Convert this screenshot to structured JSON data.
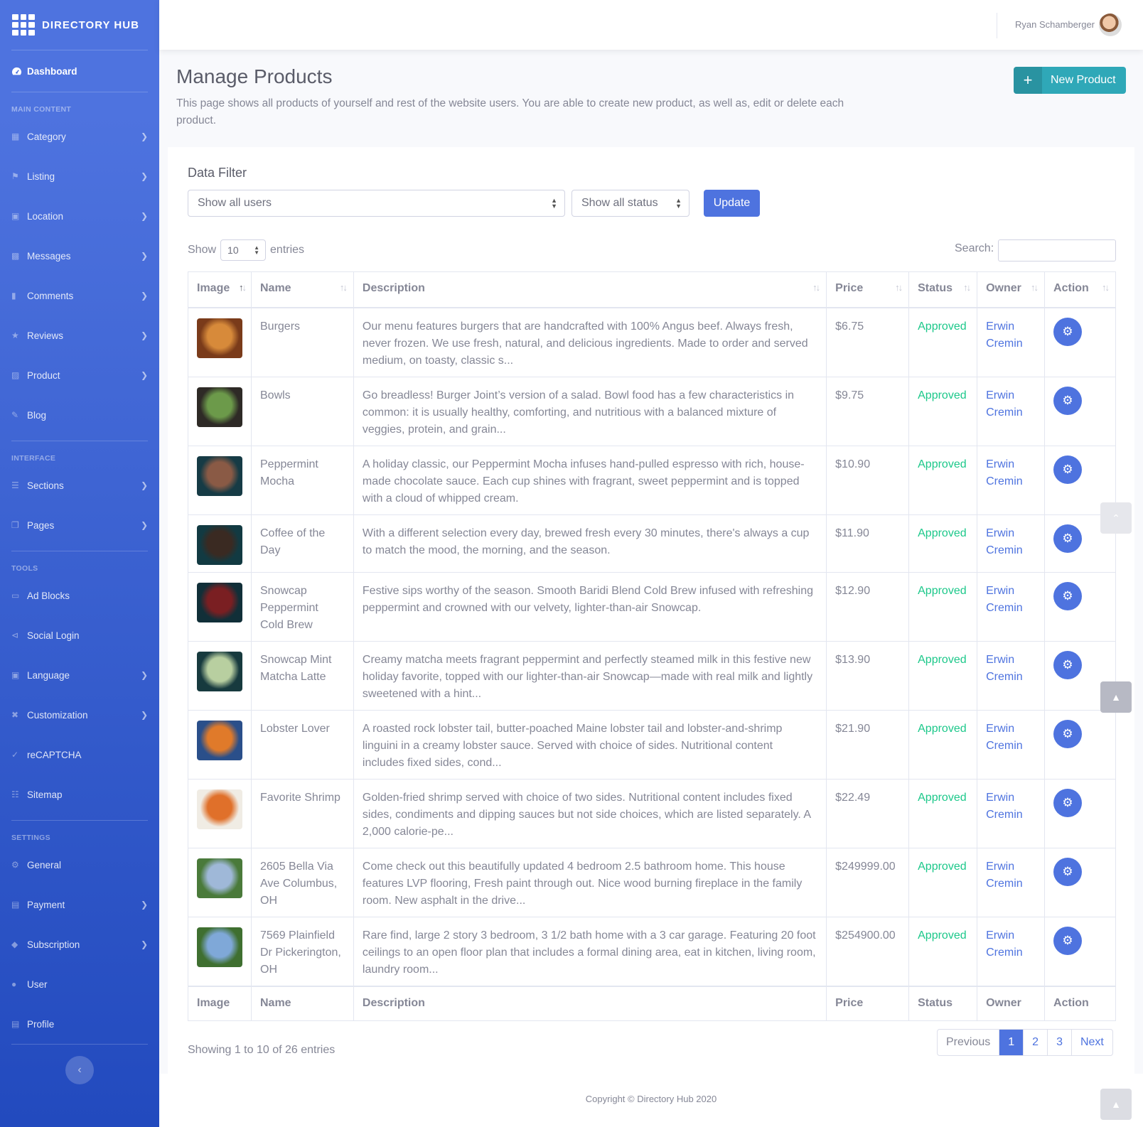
{
  "brand": {
    "name": "DIRECTORY HUB",
    "icon": "grid-icon"
  },
  "sidebar": {
    "dashboard": "Dashboard",
    "groups": [
      {
        "heading": "MAIN CONTENT",
        "items": [
          {
            "key": "category",
            "label": "Category",
            "icon": "th-icon",
            "chevron": true
          },
          {
            "key": "listing",
            "label": "Listing",
            "icon": "flag-icon",
            "chevron": true
          },
          {
            "key": "location",
            "label": "Location",
            "icon": "city-icon",
            "chevron": true
          },
          {
            "key": "messages",
            "label": "Messages",
            "icon": "comments-icon",
            "chevron": true
          },
          {
            "key": "comments",
            "label": "Comments",
            "icon": "comment-icon",
            "chevron": true
          },
          {
            "key": "reviews",
            "label": "Reviews",
            "icon": "star-icon",
            "chevron": true
          },
          {
            "key": "product",
            "label": "Product",
            "icon": "box-icon",
            "chevron": true
          },
          {
            "key": "blog",
            "label": "Blog",
            "icon": "edit-icon",
            "chevron": false
          }
        ]
      },
      {
        "heading": "INTERFACE",
        "items": [
          {
            "key": "sections",
            "label": "Sections",
            "icon": "bars-icon",
            "chevron": true
          },
          {
            "key": "pages",
            "label": "Pages",
            "icon": "copy-icon",
            "chevron": true
          }
        ]
      },
      {
        "heading": "TOOLS",
        "items": [
          {
            "key": "ad-blocks",
            "label": "Ad Blocks",
            "icon": "ad-icon",
            "chevron": false
          },
          {
            "key": "social-login",
            "label": "Social Login",
            "icon": "share-icon",
            "chevron": false
          },
          {
            "key": "language",
            "label": "Language",
            "icon": "language-icon",
            "chevron": true
          },
          {
            "key": "customization",
            "label": "Customization",
            "icon": "tools-icon",
            "chevron": true
          },
          {
            "key": "recaptcha",
            "label": "reCAPTCHA",
            "icon": "check-icon",
            "chevron": false
          },
          {
            "key": "sitemap",
            "label": "Sitemap",
            "icon": "sitemap-icon",
            "chevron": false
          }
        ]
      },
      {
        "heading": "SETTINGS",
        "items": [
          {
            "key": "general",
            "label": "General",
            "icon": "cog-icon",
            "chevron": false
          },
          {
            "key": "payment",
            "label": "Payment",
            "icon": "credit-card-icon",
            "chevron": true
          },
          {
            "key": "subscription",
            "label": "Subscription",
            "icon": "tags-icon",
            "chevron": true
          },
          {
            "key": "user",
            "label": "User",
            "icon": "users-cog-icon",
            "chevron": false
          },
          {
            "key": "profile",
            "label": "Profile",
            "icon": "id-card-icon",
            "chevron": false
          }
        ]
      }
    ]
  },
  "topbar": {
    "user_name": "Ryan Schamberger"
  },
  "page": {
    "title": "Manage Products",
    "description": "This page shows all products of yourself and rest of the website users. You are able to create new product, as well as, edit or delete each product.",
    "new_button": "New Product"
  },
  "filter": {
    "title": "Data Filter",
    "users_select": "Show all users",
    "status_select": "Show all status",
    "update_button": "Update"
  },
  "table_controls": {
    "show_label": "Show",
    "entries_label": "entries",
    "length_value": "10",
    "search_label": "Search:"
  },
  "table": {
    "columns": [
      "Image",
      "Name",
      "Description",
      "Price",
      "Status",
      "Owner",
      "Action"
    ],
    "rows": [
      {
        "name": "Burgers",
        "description": "Our menu features burgers that are handcrafted with 100% Angus beef. Always fresh, never frozen. We use fresh, natural, and delicious ingredients. Made to order and served medium, on toasty, classic s...",
        "price": "$6.75",
        "status": "Approved",
        "owner": "Erwin Cremin",
        "thumb": [
          "#d78a3a",
          "#7a3b1a"
        ]
      },
      {
        "name": "Bowls",
        "description": "Go breadless! Burger Joint’s version of a salad. Bowl food has a few characteristics in common: it is usually healthy, comforting, and nutritious with a balanced mixture of veggies, protein, and grain...",
        "price": "$9.75",
        "status": "Approved",
        "owner": "Erwin Cremin",
        "thumb": [
          "#6c9a4a",
          "#2e2a26"
        ]
      },
      {
        "name": "Peppermint Mocha",
        "description": "A holiday classic, our Peppermint Mocha infuses hand-pulled espresso with rich, house-made chocolate sauce. Each cup shines with fragrant, sweet peppermint and is topped with a cloud of whipped cream.",
        "price": "$10.90",
        "status": "Approved",
        "owner": "Erwin Cremin",
        "thumb": [
          "#8a5a45",
          "#163b45"
        ]
      },
      {
        "name": "Coffee of the Day",
        "description": "With a different selection every day, brewed fresh every 30 minutes, there's always a cup to match the mood, the morning, and the season.",
        "price": "$11.90",
        "status": "Approved",
        "owner": "Erwin Cremin",
        "thumb": [
          "#3a2a22",
          "#123a42"
        ]
      },
      {
        "name": "Snowcap Peppermint Cold Brew",
        "description": "Festive sips worthy of the season. Smooth Baridi Blend Cold Brew infused with refreshing peppermint and crowned with our velvety, lighter-than-air Snowcap.",
        "price": "$12.90",
        "status": "Approved",
        "owner": "Erwin Cremin",
        "thumb": [
          "#7a1f22",
          "#112f38"
        ]
      },
      {
        "name": "Snowcap Mint Matcha Latte",
        "description": "Creamy matcha meets fragrant peppermint and perfectly steamed milk in this festive new holiday favorite, topped with our lighter-than-air Snowcap—made with real milk and lightly sweetened with a hint...",
        "price": "$13.90",
        "status": "Approved",
        "owner": "Erwin Cremin",
        "thumb": [
          "#b8cfa0",
          "#173a3e"
        ]
      },
      {
        "name": "Lobster Lover",
        "description": "A roasted rock lobster tail, butter-poached Maine lobster tail and lobster-and-shrimp linguini in a creamy lobster sauce. Served with choice of sides. Nutritional content includes fixed sides, cond...",
        "price": "$21.90",
        "status": "Approved",
        "owner": "Erwin Cremin",
        "thumb": [
          "#e07a2a",
          "#2a4f8a"
        ]
      },
      {
        "name": "Favorite Shrimp",
        "description": "Golden-fried shrimp served with choice of two sides. Nutritional content includes fixed sides, condiments and dipping sauces but not side choices, which are listed separately. A 2,000 calorie-pe...",
        "price": "$22.49",
        "status": "Approved",
        "owner": "Erwin Cremin",
        "thumb": [
          "#e0702a",
          "#f0ece4"
        ]
      },
      {
        "name": "2605 Bella Via Ave Columbus, OH",
        "description": "Come check out this beautifully updated 4 bedroom 2.5 bathroom home. This house features LVP flooring, Fresh paint through out. Nice wood burning fireplace in the family room. New asphalt in the drive...",
        "price": "$249999.00",
        "status": "Approved",
        "owner": "Erwin Cremin",
        "thumb": [
          "#9fb8d8",
          "#4a7a3a"
        ]
      },
      {
        "name": "7569 Plainfield Dr Pickerington, OH",
        "description": "Rare find, large 2 story 3 bedroom, 3 1/2 bath home with a 3 car garage. Featuring 20 foot ceilings to an open floor plan that includes a formal dining area, eat in kitchen, living room, laundry room...",
        "price": "$254900.00",
        "status": "Approved",
        "owner": "Erwin Cremin",
        "thumb": [
          "#7fa8d8",
          "#3f6f30"
        ]
      }
    ]
  },
  "pagination": {
    "info": "Showing 1 to 10 of 26 entries",
    "previous": "Previous",
    "pages": [
      "1",
      "2",
      "3"
    ],
    "next": "Next"
  },
  "footer": {
    "copyright": "Copyright © Directory Hub 2020"
  },
  "colors": {
    "primary": "#4e73df",
    "success": "#1cc88a",
    "info": "#2fa8b8"
  }
}
